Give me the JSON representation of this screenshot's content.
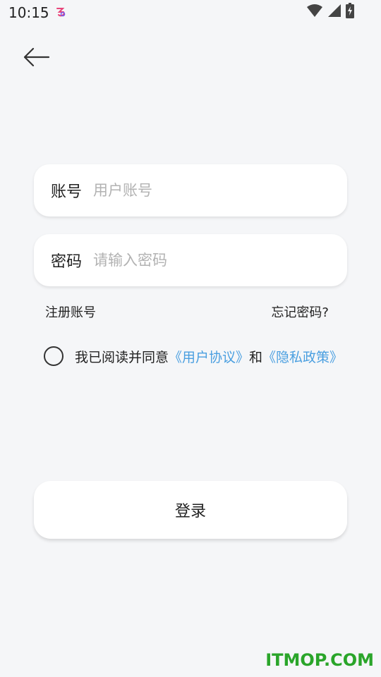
{
  "status_bar": {
    "time": "10:15",
    "icons": [
      "app-notification-icon",
      "wifi-icon",
      "cell-signal-icon",
      "battery-charging-icon"
    ]
  },
  "header": {
    "back_icon": "arrow-left-icon"
  },
  "form": {
    "account": {
      "label": "账号",
      "placeholder": "用户账号",
      "value": ""
    },
    "password": {
      "label": "密码",
      "placeholder": "请输入密码",
      "value": ""
    },
    "register_link": "注册账号",
    "forgot_link": "忘记密码?",
    "agreement": {
      "checked": false,
      "prefix": "我已阅读并同意",
      "user_agreement": "《用户协议》",
      "conjunction": "和",
      "privacy_policy": "《隐私政策》"
    },
    "login_button": "登录"
  },
  "watermark": "ITMOP.COM",
  "colors": {
    "background": "#f5f6f8",
    "link": "#4a9fe0",
    "watermark": "#2aa52a"
  }
}
